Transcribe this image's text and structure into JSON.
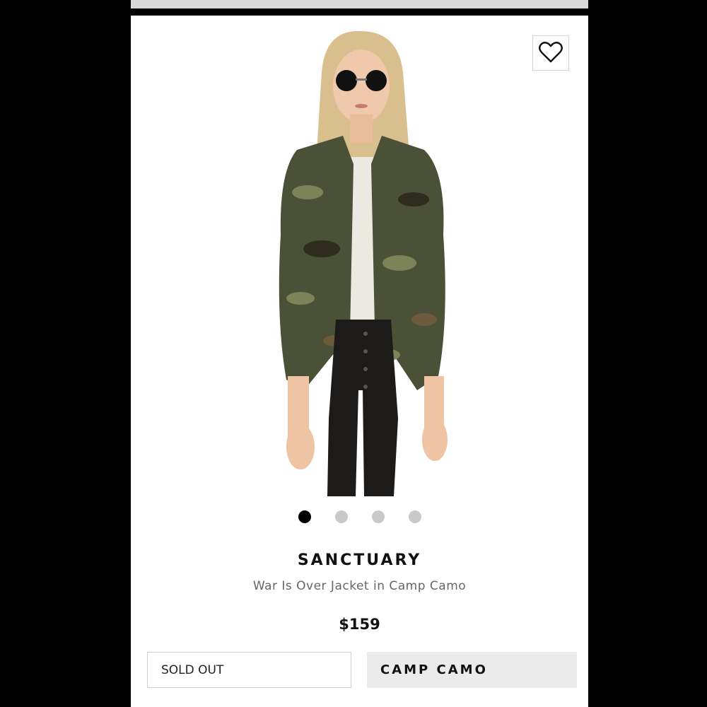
{
  "product": {
    "brand": "SANCTUARY",
    "name": "War Is Over Jacket in Camp Camo",
    "price": "$159",
    "image_alt": "Model wearing camo jacket, white tee and black leather pants"
  },
  "carousel": {
    "total": 4,
    "active_index": 0
  },
  "options": {
    "size_value": "SOLD OUT",
    "color_value": "CAMP CAMO"
  },
  "icons": {
    "wishlist": "heart-icon"
  },
  "colors": {
    "dot_active": "#000000",
    "dot_inactive": "#c9c9c9",
    "color_button_bg": "#ebebeb"
  }
}
